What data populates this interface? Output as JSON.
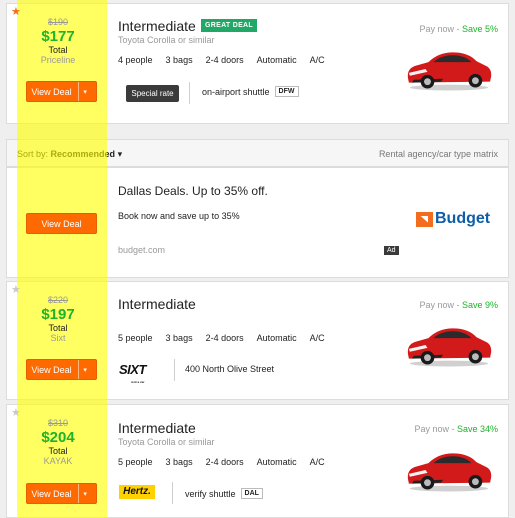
{
  "deals": [
    {
      "old_price": "$190",
      "price": "$177",
      "price_label": "Total",
      "provider": "Priceline",
      "title": "Intermediate",
      "badge": "GREAT DEAL",
      "subtitle": "Toyota Corolla or similar",
      "specs": [
        "4 people",
        "3 bags",
        "2-4 doors",
        "Automatic",
        "A/C"
      ],
      "pay_now": "Pay now - ",
      "save": "Save 5%",
      "button": "View Deal",
      "tag": "Special rate",
      "pickup": "on-airport shuttle",
      "airport_code": "DFW"
    },
    {
      "old_price": "$220",
      "price": "$197",
      "price_label": "Total",
      "provider": "Sixt",
      "title": "Intermediate",
      "specs": [
        "5 people",
        "3 bags",
        "2-4 doors",
        "Automatic",
        "A/C"
      ],
      "pay_now": "Pay now - ",
      "save": "Save 9%",
      "button": "View Deal",
      "pickup": "400 North Olive Street",
      "logo_text": "SIXT",
      "logo_small": "rent a car"
    },
    {
      "old_price": "$310",
      "price": "$204",
      "price_label": "Total",
      "provider": "KAYAK",
      "title": "Intermediate",
      "subtitle": "Toyota Corolla or similar",
      "specs": [
        "5 people",
        "3 bags",
        "2-4 doors",
        "Automatic",
        "A/C"
      ],
      "pay_now": "Pay now - ",
      "save": "Save 34%",
      "button": "View Deal",
      "pickup": "verify shuttle",
      "airport_code": "DAL",
      "logo_text": "Hertz."
    }
  ],
  "sort_bar": {
    "label": "Sort by:",
    "value": "Recommended",
    "caret": "▾",
    "right_link": "Rental agency/car type matrix"
  },
  "ad": {
    "title": "Dallas Deals. Up to 35% off.",
    "subtitle": "Book now and save up to 35%",
    "url": "budget.com",
    "ad_tag": "Ad",
    "button": "View Deal",
    "logo_text": "Budget"
  },
  "icons": {
    "star": "★",
    "caret": "▾"
  },
  "colors": {
    "accent_orange": "#ff6a00",
    "price_green": "#1db32a",
    "badge_green": "#21a866",
    "highlight": "#ffff00",
    "car_red": "#d31a1a"
  }
}
